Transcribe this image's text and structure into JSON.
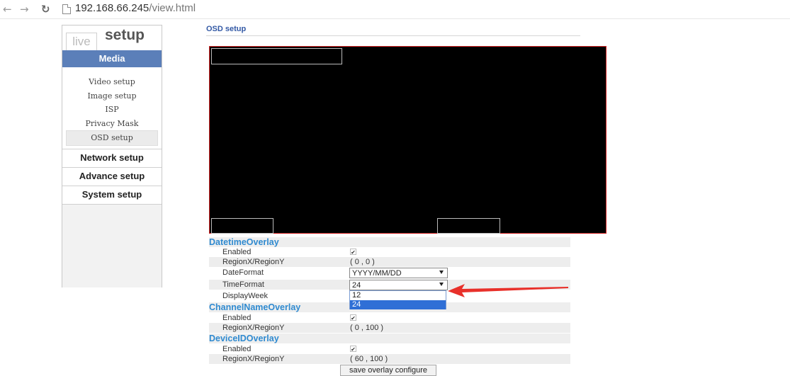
{
  "browser": {
    "back_icon": "back-arrow",
    "forward_icon": "forward-arrow",
    "reload_icon": "reload",
    "url_host": "192.168.66.245",
    "url_path": "/view.html"
  },
  "sidebar": {
    "tab_live": "live",
    "tab_setup": "setup",
    "media_header": "Media",
    "media_items": [
      {
        "label": "Video setup"
      },
      {
        "label": "Image setup"
      },
      {
        "label": "ISP"
      },
      {
        "label": "Privacy Mask"
      },
      {
        "label": "OSD setup",
        "active": true
      }
    ],
    "sections": [
      "Network setup",
      "Advance setup",
      "System setup"
    ]
  },
  "main": {
    "title": "OSD setup",
    "datetime": {
      "title": "DatetimeOverlay",
      "enabled_label": "Enabled",
      "enabled": true,
      "region_label": "RegionX/RegionY",
      "region_value": "( 0 ,  0 )",
      "dateformat_label": "DateFormat",
      "dateformat_value": "YYYY/MM/DD",
      "timeformat_label": "TimeFormat",
      "timeformat_value": "24",
      "timeformat_options": [
        "12",
        "24"
      ],
      "displayweek_label": "DisplayWeek"
    },
    "channel": {
      "title": "ChannelNameOverlay",
      "enabled_label": "Enabled",
      "enabled": true,
      "region_label": "RegionX/RegionY",
      "region_value": "( 0 ,  100 )"
    },
    "device": {
      "title": "DeviceIDOverlay",
      "enabled_label": "Enabled",
      "enabled": true,
      "region_label": "RegionX/RegionY",
      "region_value": "( 60 ,  100 )"
    },
    "save_button": "save overlay configure"
  },
  "colors": {
    "accent": "#5b7fb9",
    "group_title": "#2f8ad0",
    "preview_border": "#d02020",
    "annotation_arrow": "#e8302a",
    "dropdown_highlight": "#2f6fd6"
  }
}
